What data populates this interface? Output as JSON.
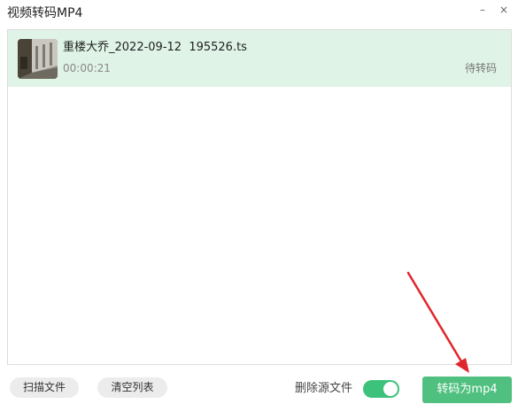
{
  "window": {
    "title": "视频转码MP4",
    "minimize_glyph": "–",
    "close_glyph": "×"
  },
  "list": {
    "items": [
      {
        "file_name": "重楼大乔_2022-09-12  195526.ts",
        "duration": "00:00:21",
        "status": "待转码",
        "thumbnail_icon": "video-thumbnail"
      }
    ]
  },
  "footer": {
    "scan_label": "扫描文件",
    "clear_label": "清空列表",
    "delete_source_label": "删除源文件",
    "delete_source_enabled": true,
    "convert_label": "转码为mp4"
  },
  "colors": {
    "accent_green": "#4fc07f",
    "toggle_green": "#3cc27b",
    "selected_row": "#dff3e7",
    "annotation_arrow": "#e0262b"
  }
}
